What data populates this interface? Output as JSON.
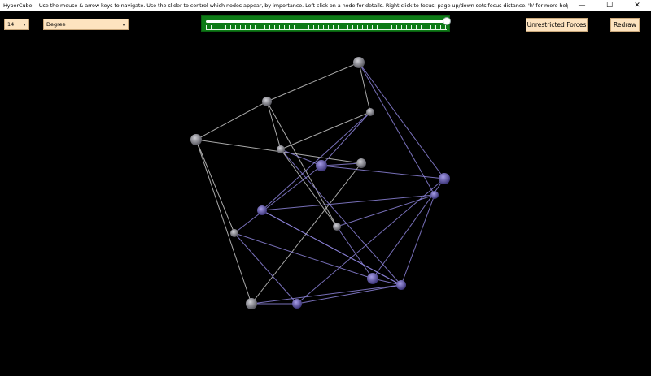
{
  "window": {
    "title": "HyperCube -- Use the mouse & arrow keys to navigate. Use the slider to control which nodes appear, by importance. Left click on a node for details. Right click to focus; page up/down sets focus distance. 'h' for more help.",
    "controls": {
      "minimize_glyph": "—",
      "maximize_glyph": "☐",
      "close_glyph": "✕"
    }
  },
  "toolbar": {
    "number_select": {
      "value": "14",
      "caret": "▾"
    },
    "metric_select": {
      "value": "Degree",
      "caret": "▾"
    },
    "importance_slider": {
      "value": 1.0
    },
    "forces_button": "Unrestricted Forces",
    "redraw_button": "Redraw"
  },
  "colors": {
    "background": "#000000",
    "dropdown_bg": "#fde3bf",
    "slider_panel": "#0d7a16",
    "grey_node": "#8a8a92",
    "purple_node": "#6a5fb0",
    "grey_edge": "#c8c8c8",
    "purple_edge": "#8c82d8"
  },
  "graph": {
    "nodes": [
      {
        "id": "n0",
        "kind": "grey"
      },
      {
        "id": "n1",
        "kind": "grey"
      },
      {
        "id": "n2",
        "kind": "grey"
      },
      {
        "id": "n3",
        "kind": "grey"
      },
      {
        "id": "n4",
        "kind": "grey"
      },
      {
        "id": "n5",
        "kind": "purple"
      },
      {
        "id": "n6",
        "kind": "grey"
      },
      {
        "id": "n7",
        "kind": "purple"
      },
      {
        "id": "n8",
        "kind": "purple"
      },
      {
        "id": "n9",
        "kind": "purple"
      },
      {
        "id": "n10",
        "kind": "grey"
      },
      {
        "id": "n11",
        "kind": "grey"
      },
      {
        "id": "n12",
        "kind": "purple"
      },
      {
        "id": "n13",
        "kind": "purple"
      },
      {
        "id": "n14",
        "kind": "purple"
      },
      {
        "id": "n15",
        "kind": "grey"
      },
      {
        "id": "n16",
        "kind": "purple"
      }
    ],
    "edges": [
      [
        "n0",
        "n1"
      ],
      [
        "n0",
        "n3"
      ],
      [
        "n0",
        "n7"
      ],
      [
        "n0",
        "n8"
      ],
      [
        "n1",
        "n2"
      ],
      [
        "n1",
        "n4"
      ],
      [
        "n1",
        "n10"
      ],
      [
        "n2",
        "n6"
      ],
      [
        "n2",
        "n11"
      ],
      [
        "n2",
        "n15"
      ],
      [
        "n3",
        "n4"
      ],
      [
        "n3",
        "n5"
      ],
      [
        "n3",
        "n9"
      ],
      [
        "n4",
        "n5"
      ],
      [
        "n4",
        "n13"
      ],
      [
        "n4",
        "n10"
      ],
      [
        "n5",
        "n11"
      ],
      [
        "n5",
        "n7"
      ],
      [
        "n6",
        "n5"
      ],
      [
        "n6",
        "n15"
      ],
      [
        "n7",
        "n14"
      ],
      [
        "n7",
        "n12"
      ],
      [
        "n8",
        "n9"
      ],
      [
        "n8",
        "n10"
      ],
      [
        "n8",
        "n16"
      ],
      [
        "n9",
        "n13"
      ],
      [
        "n9",
        "n16"
      ],
      [
        "n10",
        "n12"
      ],
      [
        "n11",
        "n12"
      ],
      [
        "n11",
        "n14"
      ],
      [
        "n12",
        "n16"
      ],
      [
        "n13",
        "n14"
      ],
      [
        "n14",
        "n15"
      ],
      [
        "n15",
        "n16"
      ]
    ]
  }
}
